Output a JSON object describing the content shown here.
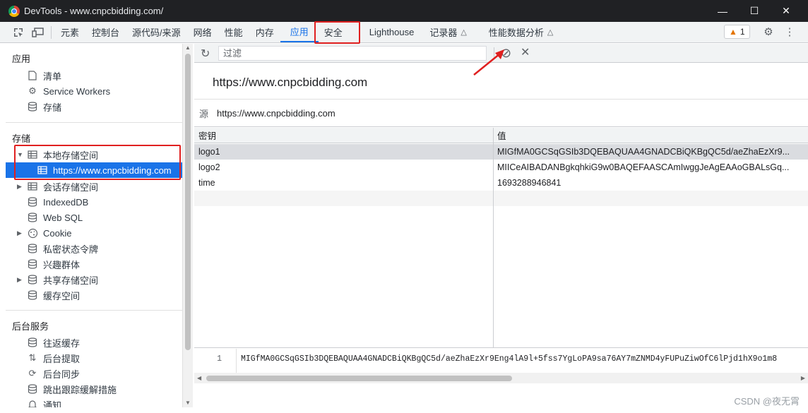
{
  "window": {
    "title": "DevTools - www.cnpcbidding.com/",
    "controls": [
      "minimize",
      "maximize",
      "close"
    ]
  },
  "tabs": [
    {
      "label": "元素"
    },
    {
      "label": "控制台"
    },
    {
      "label": "源代码/来源"
    },
    {
      "label": "网络"
    },
    {
      "label": "性能"
    },
    {
      "label": "内存"
    },
    {
      "label": "应用",
      "active": true
    },
    {
      "label": "安全"
    },
    {
      "label": "Lighthouse"
    },
    {
      "label": "记录器"
    },
    {
      "label": "性能数据分析"
    }
  ],
  "issues_count": "1",
  "sidebar": {
    "app_title": "应用",
    "app_items": [
      {
        "label": "清单",
        "icon": "document-icon"
      },
      {
        "label": "Service Workers",
        "icon": "gears-icon"
      },
      {
        "label": "存储",
        "icon": "database-icon"
      }
    ],
    "storage_title": "存储",
    "storage_items": [
      {
        "label": "本地存储空间",
        "icon": "table-icon",
        "expanded": true
      },
      {
        "label": "https://www.cnpcbidding.com",
        "icon": "table-icon",
        "selected": true
      },
      {
        "label": "会话存储空间",
        "icon": "table-icon"
      },
      {
        "label": "IndexedDB",
        "icon": "database-icon"
      },
      {
        "label": "Web SQL",
        "icon": "database-icon"
      },
      {
        "label": "Cookie",
        "icon": "cookie-icon"
      },
      {
        "label": "私密状态令牌",
        "icon": "database-icon"
      },
      {
        "label": "兴趣群体",
        "icon": "database-icon"
      },
      {
        "label": "共享存储空间",
        "icon": "database-icon"
      },
      {
        "label": "缓存空间",
        "icon": "database-icon"
      }
    ],
    "bg_title": "后台服务",
    "bg_items": [
      {
        "label": "往返缓存",
        "icon": "database-icon"
      },
      {
        "label": "后台提取",
        "icon": "updown-icon"
      },
      {
        "label": "后台同步",
        "icon": "sync-icon"
      },
      {
        "label": "跳出跟踪缓解措施",
        "icon": "database-icon"
      },
      {
        "label": "通知",
        "icon": "bell-icon"
      }
    ]
  },
  "toolbar": {
    "filter_placeholder": "过滤"
  },
  "main": {
    "origin_heading": "https://www.cnpcbidding.com",
    "origin_label": "源",
    "origin_value": "https://www.cnpcbidding.com",
    "columns": [
      "密钥",
      "值"
    ],
    "rows": [
      {
        "key": "logo1",
        "value": "MIGfMA0GCSqGSIb3DQEBAQUAA4GNADCBiQKBgQC5d/aeZhaEzXr9..."
      },
      {
        "key": "logo2",
        "value": "MIICeAIBADANBgkqhkiG9w0BAQEFAASCAmIwggJeAgEAAoGBALsGq..."
      },
      {
        "key": "time",
        "value": "1693288946841"
      }
    ],
    "preview_line": "1",
    "preview_text": "MIGfMA0GCSqGSIb3DQEBAQUAA4GNADCBiQKBgQC5d/aeZhaEzXr9Eng4lA9l+5fss7YgLoPA9sa76AY7mZNMD4yFUPuZiwOfC6lPjd1hX9o1m8"
  },
  "watermark": "CSDN @夜无霄",
  "colors": {
    "accent": "#1a73e8",
    "highlight": "#e02020",
    "titlebar": "#202124"
  }
}
